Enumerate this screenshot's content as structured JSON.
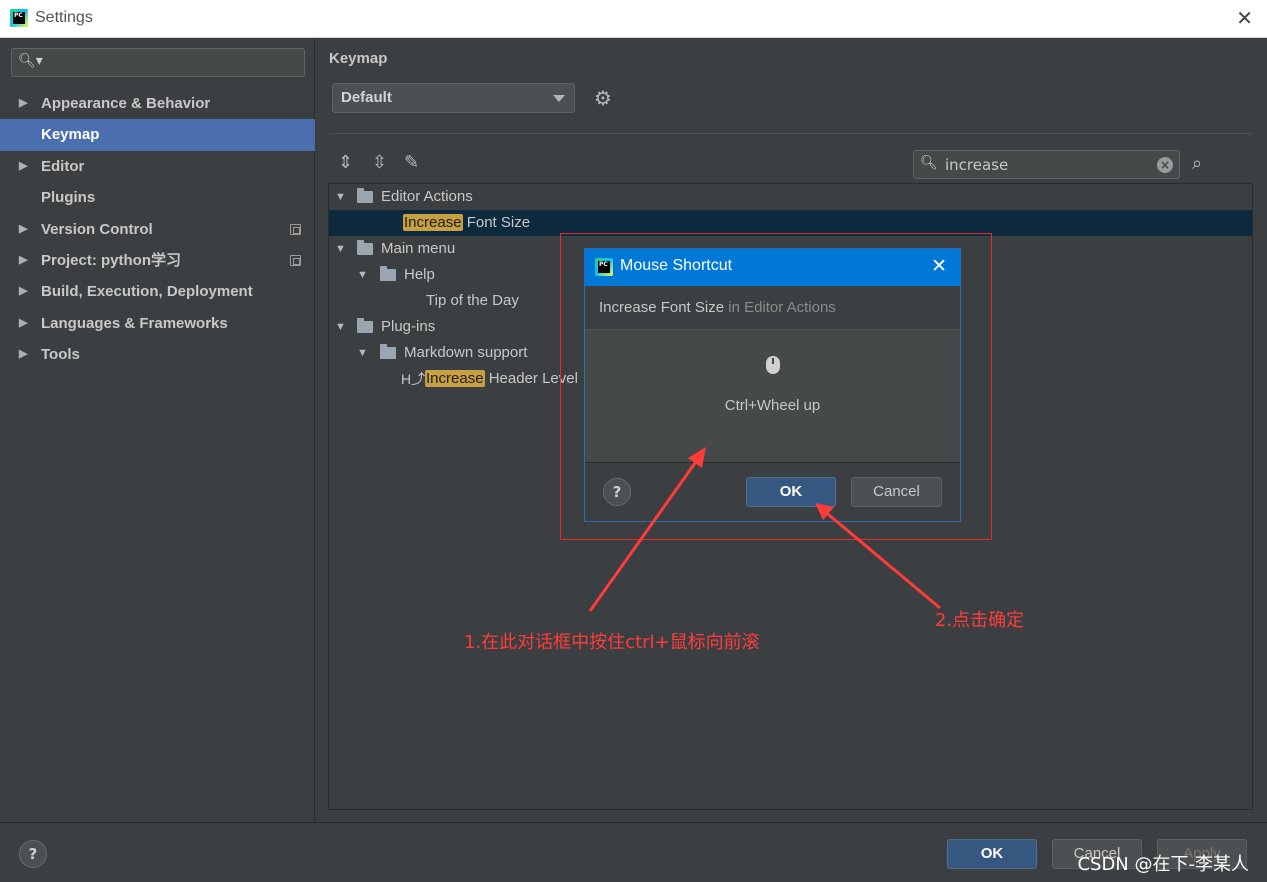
{
  "window": {
    "title": "Settings",
    "close_glyph": "✕",
    "logo_text": "PC"
  },
  "sidebar": {
    "search_placeholder": "",
    "items": [
      {
        "label": "Appearance & Behavior",
        "expandable": true,
        "selected": false
      },
      {
        "label": "Keymap",
        "expandable": false,
        "selected": true
      },
      {
        "label": "Editor",
        "expandable": true,
        "selected": false
      },
      {
        "label": "Plugins",
        "expandable": false,
        "selected": false
      },
      {
        "label": "Version Control",
        "expandable": true,
        "selected": false,
        "project_icon": true
      },
      {
        "label": "Project: python学习",
        "expandable": true,
        "selected": false,
        "project_icon": true
      },
      {
        "label": "Build, Execution, Deployment",
        "expandable": true,
        "selected": false
      },
      {
        "label": "Languages & Frameworks",
        "expandable": true,
        "selected": false
      },
      {
        "label": "Tools",
        "expandable": true,
        "selected": false
      }
    ]
  },
  "main": {
    "title": "Keymap",
    "keymap_select": "Default",
    "filter_value": "increase",
    "tree": {
      "editor_actions": "Editor Actions",
      "increase_font_size": {
        "match": "Increase",
        "rest": " Font Size"
      },
      "main_menu": "Main menu",
      "help": "Help",
      "tip_of_the_day": "Tip of the Day",
      "plug_ins": "Plug-ins",
      "markdown_support": "Markdown support",
      "increase_header_level": {
        "match": "Increase",
        "rest": " Header Level"
      }
    }
  },
  "dialog": {
    "title": "Mouse Shortcut",
    "action": "Increase Font Size",
    "context": " in Editor Actions",
    "shortcut": "Ctrl+Wheel up",
    "ok": "OK",
    "cancel": "Cancel",
    "help": "?"
  },
  "footer": {
    "help": "?",
    "ok": "OK",
    "cancel": "Cancel",
    "apply": "Apply",
    "watermark": "CSDN @在下-李某人"
  },
  "annotations": {
    "step1": "1.在此对话框中按住ctrl+鼠标向前滚",
    "step2": "2.点击确定",
    "color": "#ff3b3b"
  },
  "colors": {
    "accent": "#4b6eaf",
    "selection_row": "#0d293e",
    "dialog_title": "#0078d7",
    "highlight": "#c9a041"
  }
}
